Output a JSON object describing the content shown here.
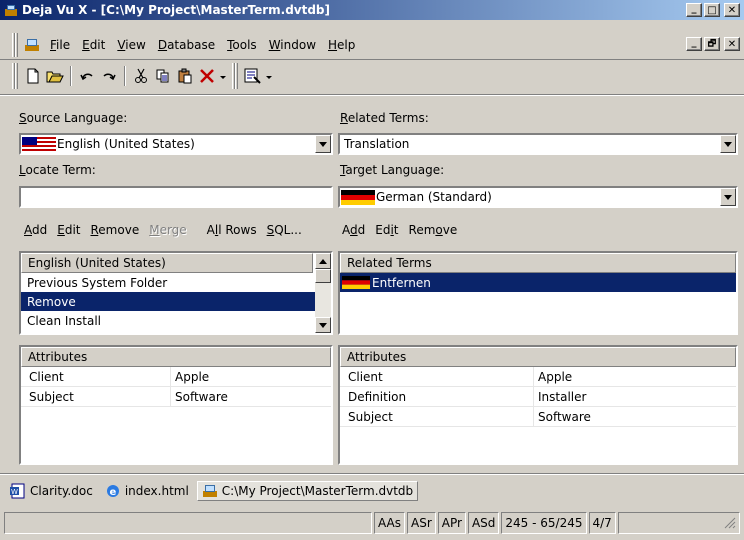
{
  "window": {
    "title": "Deja Vu X - [C:\\My Project\\MasterTerm.dvtdb]",
    "min_glyph": "_",
    "max_glyph": "□",
    "close_glyph": "✕",
    "child_min": "_",
    "child_restore": "🗗",
    "child_close": "✕"
  },
  "menu": {
    "items": [
      {
        "accel": "F",
        "rest": "ile"
      },
      {
        "accel": "E",
        "rest": "dit"
      },
      {
        "accel": "V",
        "rest": "iew"
      },
      {
        "accel": "D",
        "rest": "atabase"
      },
      {
        "accel": "T",
        "rest": "ools"
      },
      {
        "accel": "W",
        "rest": "indow"
      },
      {
        "accel": "H",
        "rest": "elp"
      }
    ]
  },
  "toolbar": {
    "icons": [
      "new-icon",
      "open-icon",
      "undo-icon",
      "redo-icon",
      "cut-icon",
      "copy-icon",
      "paste-icon",
      "delete-icon",
      "properties-icon"
    ]
  },
  "source": {
    "label_accel": "S",
    "label_rest": "ource Language:",
    "value": "English (United States)"
  },
  "related": {
    "label_accel": "R",
    "label_rest": "elated Terms:",
    "value": "Translation"
  },
  "locate": {
    "label_accel": "L",
    "label_rest": "ocate Term:",
    "value": ""
  },
  "target": {
    "label_accel": "T",
    "label_rest": "arget Language:",
    "value": "German (Standard)"
  },
  "left_actions": {
    "add_accel": "A",
    "add_rest": "dd",
    "edit_accel": "E",
    "edit_rest": "dit",
    "remove_accel": "R",
    "remove_rest": "emove",
    "merge_accel": "M",
    "merge_rest": "erge",
    "allrows_pre": "A",
    "allrows_accel": "l",
    "allrows_rest": "l Rows",
    "sql_accel": "S",
    "sql_rest": "QL..."
  },
  "right_actions": {
    "add_pre": "A",
    "add_accel": "d",
    "add_rest": "d",
    "edit_pre": "Ed",
    "edit_accel": "i",
    "edit_rest": "t",
    "remove_pre": "Rem",
    "remove_accel": "o",
    "remove_rest": "ve"
  },
  "term_list": {
    "header": "English (United States)",
    "rows": [
      "Previous System Folder",
      "Remove",
      "Clean Install"
    ],
    "selected_index": 1
  },
  "related_list": {
    "header": "Related Terms",
    "rows": [
      "Entfernen"
    ]
  },
  "left_attrs": {
    "header": "Attributes",
    "rows": [
      {
        "name": "Client",
        "value": "Apple"
      },
      {
        "name": "Subject",
        "value": "Software"
      }
    ]
  },
  "right_attrs": {
    "header": "Attributes",
    "rows": [
      {
        "name": "Client",
        "value": "Apple"
      },
      {
        "name": "Definition",
        "value": "Installer"
      },
      {
        "name": "Subject",
        "value": "Software"
      }
    ]
  },
  "doc_tabs": [
    {
      "label": "Clarity.doc",
      "icon": "word-document-icon"
    },
    {
      "label": "index.html",
      "icon": "ie-document-icon"
    },
    {
      "label": "C:\\My Project\\MasterTerm.dvtdb",
      "icon": "dejavu-document-icon"
    }
  ],
  "status": {
    "panes": [
      "AAs",
      "ASr",
      "APr",
      "ASd",
      "245 - 65/245",
      "4/7"
    ]
  },
  "colors": {
    "selection": "#0a246a",
    "face": "#d4d0c8",
    "title_gradient_start": "#0a246a",
    "title_gradient_end": "#a6caf0"
  }
}
